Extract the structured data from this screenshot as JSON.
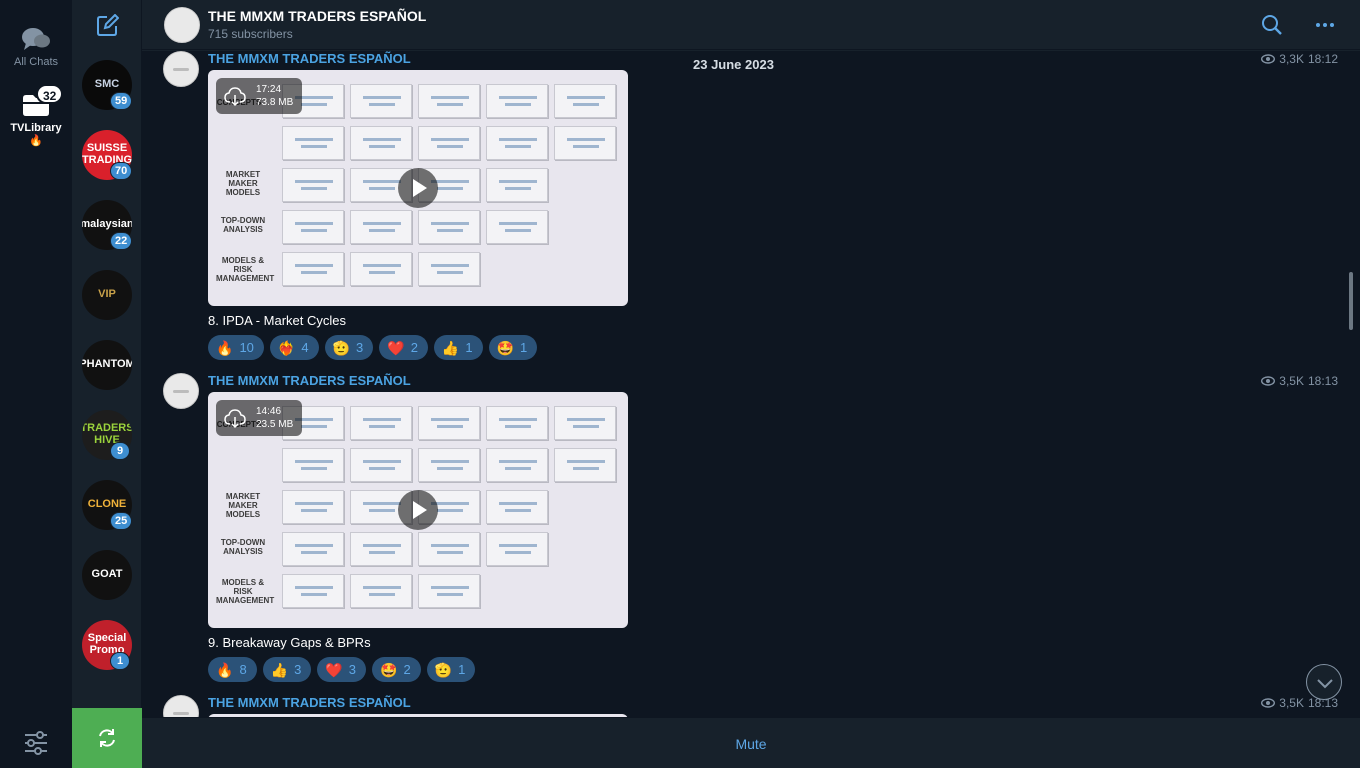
{
  "folders": {
    "all_chats_label": "All Chats",
    "library_label": "TVLibrary",
    "library_emoji": "🔥",
    "library_badge": "32"
  },
  "chatlist": {
    "chats": [
      {
        "avatar_text": "SMC",
        "unread": "59",
        "bg": "#0a0a0a",
        "fg": "#c9d4e4"
      },
      {
        "avatar_text": "SUISSE TRADING",
        "unread": "70",
        "bg": "#d9202b",
        "fg": "#ffffff"
      },
      {
        "avatar_text": "malaysian",
        "unread": "22",
        "bg": "#111111",
        "fg": "#ffffff"
      },
      {
        "avatar_text": "VIP",
        "unread": "",
        "bg": "#111111",
        "fg": "#c9a24a"
      },
      {
        "avatar_text": "PHANTOM",
        "unread": "",
        "bg": "#111111",
        "fg": "#ffffff"
      },
      {
        "avatar_text": "TRADERS HIVE",
        "unread": "9",
        "bg": "#1d1d1d",
        "fg": "#9bd33c"
      },
      {
        "avatar_text": "CLONE",
        "unread": "25",
        "bg": "#111111",
        "fg": "#f0b23a"
      },
      {
        "avatar_text": "GOAT",
        "unread": "",
        "bg": "#111111",
        "fg": "#ffffff"
      },
      {
        "avatar_text": "Special Promo",
        "unread": "1",
        "bg": "#c0202b",
        "fg": "#ffffff"
      }
    ]
  },
  "header": {
    "title": "THE MMXM TRADERS ESPAÑOL",
    "subtitle": "715 subscribers"
  },
  "date_separator": "23 June 2023",
  "video_labels": {
    "market_maker_models": "MARKET MAKER MODELS",
    "top_down_analysis": "TOP-DOWN ANALYSIS",
    "models_risk": "MODELS & RISK MANAGEMENT",
    "concepts": "CONCEPTS"
  },
  "messages": [
    {
      "author": "THE MMXM TRADERS ESPAÑOL",
      "views": "3,3K",
      "time": "18:12",
      "duration": "17:24",
      "size": "73.8 MB",
      "caption": "8. IPDA - Market Cycles",
      "reactions": [
        {
          "emoji": "🔥",
          "count": "10"
        },
        {
          "emoji": "❤️‍🔥",
          "count": "4"
        },
        {
          "emoji": "🫡",
          "count": "3"
        },
        {
          "emoji": "❤️",
          "count": "2"
        },
        {
          "emoji": "👍",
          "count": "1"
        },
        {
          "emoji": "🤩",
          "count": "1"
        }
      ]
    },
    {
      "author": "THE MMXM TRADERS ESPAÑOL",
      "views": "3,5K",
      "time": "18:13",
      "duration": "14:46",
      "size": "23.5 MB",
      "caption": "9. Breakaway Gaps & BPRs",
      "reactions": [
        {
          "emoji": "🔥",
          "count": "8"
        },
        {
          "emoji": "👍",
          "count": "3"
        },
        {
          "emoji": "❤️",
          "count": "3"
        },
        {
          "emoji": "🤩",
          "count": "2"
        },
        {
          "emoji": "🫡",
          "count": "1"
        }
      ]
    },
    {
      "author": "THE MMXM TRADERS ESPAÑOL",
      "views": "3,5K",
      "time": "18:13"
    }
  ],
  "bottom": {
    "mute_label": "Mute"
  },
  "colors": {
    "accent": "#5ea7e6",
    "author": "#4ba3e2",
    "reaction_bg": "#2b5278",
    "refresh_green": "#4eae53"
  }
}
